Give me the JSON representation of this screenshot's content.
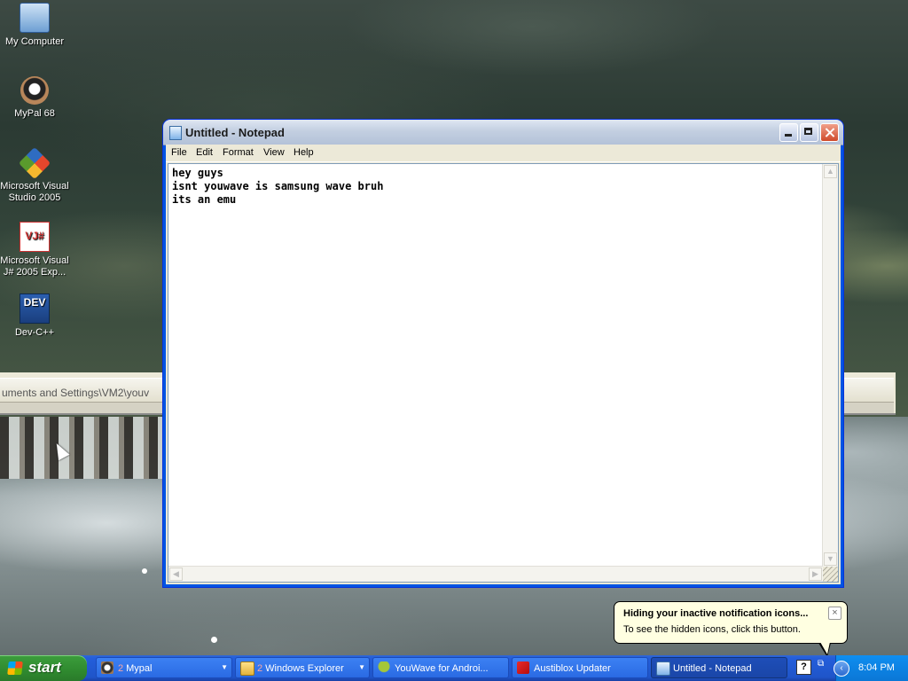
{
  "desktop": {
    "icons": [
      {
        "label": "My Computer"
      },
      {
        "label": "MyPal 68"
      },
      {
        "label": "Microsoft Visual Studio 2005"
      },
      {
        "label": "Microsoft Visual J# 2005 Exp..."
      },
      {
        "label": "Dev-C++"
      }
    ],
    "icon_glyphs": {
      "vj": "VJ#",
      "dev": "DEV"
    }
  },
  "background_window": {
    "address_text": "uments and Settings\\VM2\\youv"
  },
  "notepad": {
    "title": "Untitled - Notepad",
    "menu": [
      "File",
      "Edit",
      "Format",
      "View",
      "Help"
    ],
    "content": "hey guys\nisnt youwave is samsung wave bruh\nits an emu"
  },
  "taskbar": {
    "start_label": "start",
    "tasks": [
      {
        "count": "2",
        "label": "Mypal",
        "grouped": true
      },
      {
        "count": "2",
        "label": "Windows Explorer",
        "grouped": true
      },
      {
        "label": "YouWave for Androi..."
      },
      {
        "label": "Austiblox Updater"
      },
      {
        "label": "Untitled - Notepad",
        "active": true
      }
    ],
    "help_glyph": "?",
    "clock": "8:04 PM"
  },
  "balloon": {
    "title": "Hiding your inactive notification icons...",
    "body": "To see the hidden icons, click this button.",
    "close": "×"
  }
}
